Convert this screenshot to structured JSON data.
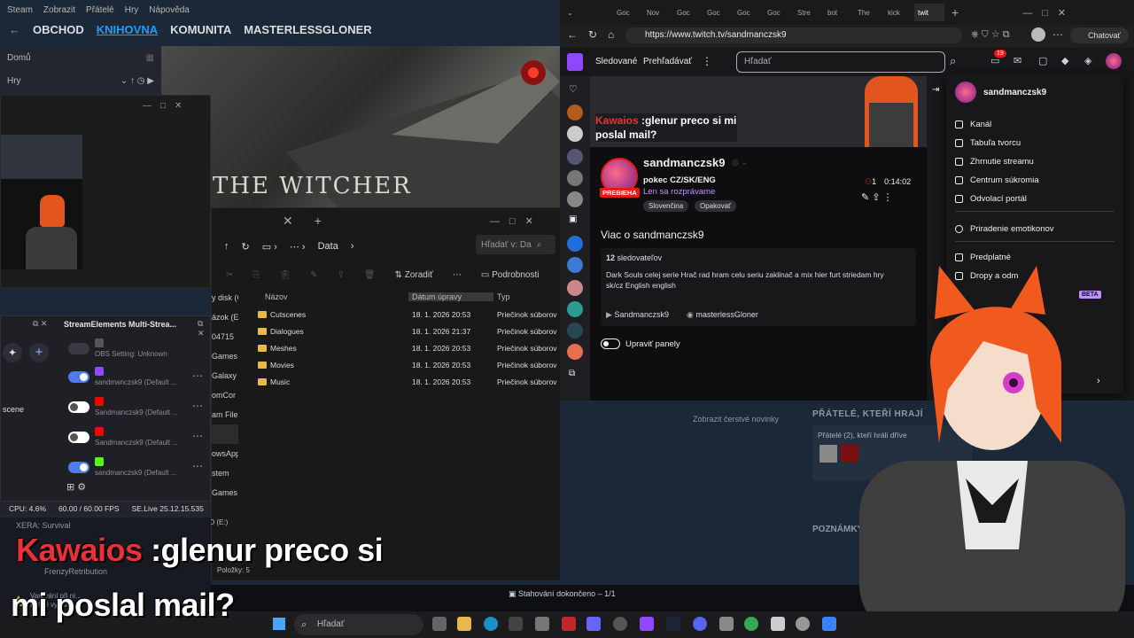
{
  "steam": {
    "menu": [
      "Steam",
      "Zobrazit",
      "Přátelé",
      "Hry",
      "Nápověda"
    ],
    "nav": [
      "OBCHOD",
      "KNIHOVNA",
      "KOMUNITA",
      "MASTERLESSGLONER"
    ],
    "nav_active_index": 1,
    "home_label": "Domů",
    "games_label": "Hry",
    "hero_title": "THE WITCHER",
    "news_link": "Zobrazit čerstvé novinky",
    "friends_heading": "PŘÁTELÉ, KTEŘÍ HRAJÍ",
    "friends_sub": "Přátelé (2), kteří hráli dříve",
    "notes_heading": "POZNÁMKY",
    "download_status": "Stahování dokončeno – 1/1"
  },
  "explorer": {
    "path": "Data",
    "search_placeholder": "Hľadať v: Da",
    "sort_label": "Zoradiť",
    "details_label": "Podrobnosti",
    "columns": [
      "Názov",
      "Dátum úpravy",
      "Typ"
    ],
    "nav_items": [
      "y disk (C",
      "ázok (E",
      "04715",
      "Games",
      "Galaxy",
      "omCor",
      "am File",
      "",
      "owsApp",
      "stem",
      "Games"
    ],
    "rows": [
      {
        "name": "Cutscenes",
        "date": "18. 1. 2026 20:53",
        "type": "Priečinok súborov"
      },
      {
        "name": "Dialogues",
        "date": "18. 1. 2026 21:37",
        "type": "Priečinok súborov"
      },
      {
        "name": "Meshes",
        "date": "18. 1. 2026 20:53",
        "type": "Priečinok súborov"
      },
      {
        "name": "Movies",
        "date": "18. 1. 2026 20:53",
        "type": "Priečinok súborov"
      },
      {
        "name": "Music",
        "date": "18. 1. 2026 20:53",
        "type": "Priečinok súborov"
      }
    ],
    "status": "Položky: 5",
    "drive": "SSD (E:)"
  },
  "streamelements": {
    "title": "StreamElements Multi-Strea...",
    "rows": [
      {
        "label": "OBS Setting: Unknown",
        "on": false,
        "icon_color": "#555555"
      },
      {
        "label": "sandmanczsk9 (Default ...",
        "on": true,
        "icon_color": "#9146ff"
      },
      {
        "label": "Sandmanczsk9 (Default ...",
        "on": false,
        "icon_color": "#ff0000"
      },
      {
        "label": "Sandmanczsk9 (Default ...",
        "on": false,
        "icon_color": "#ff0000"
      },
      {
        "label": "sandmanczsk9 (Default ...",
        "on": true,
        "icon_color": "#53fc18"
      }
    ],
    "scene_label": "scene"
  },
  "obs_status": {
    "cpu": "CPU: 4.6%",
    "fps": "60.00 / 60.00 FPS",
    "version": "SE.Live 25.12.15.535"
  },
  "browser": {
    "tabs": [
      "Goc",
      "Nov",
      "Goc",
      "Goc",
      "Goc",
      "Goc",
      "Stre",
      "bot",
      "The",
      "kick",
      "twit"
    ],
    "url": "https://www.twitch.tv/sandmanczsk9",
    "chat_button": "Chatovať"
  },
  "twitch": {
    "nav_following": "Sledované",
    "nav_browse": "Prehľadávať",
    "search_placeholder": "Hľadať",
    "notif_count": "19",
    "overlay_user": "Kawaios",
    "overlay_text": ":glenur preco si mi poslal mail?",
    "channel_name": "sandmanczsk9",
    "live_badge": "PREBIEHA",
    "stream_title": "pokec CZ/SK/ENG",
    "category": "Len sa rozprávame",
    "tags": [
      "Slovenčina",
      "Opakovať"
    ],
    "viewers": "1",
    "uptime": "0:14:02",
    "about_title": "Viac o sandmanczsk9",
    "followers_count": "12",
    "followers_label": "sledovateľov",
    "description": "Dark Souls celej serie Hrač rad hram celu seriu zaklinač a mix hier furt striedam hry sk/cz English english",
    "link_youtube": "Sandmanczsk9",
    "link_discord": "masterlessGloner",
    "edit_panels": "Upraviť panely"
  },
  "user_menu": {
    "username": "sandmanczsk9",
    "items": [
      "Kanál",
      "Tabuľa tvorcu",
      "Zhrnutie streamu",
      "Centrum súkromia",
      "Odvolací portál",
      "Priradenie emotikonov",
      "Predplatné",
      "Dropy a odm"
    ],
    "beta": "BETA"
  },
  "taskbar": {
    "search_placeholder": "Hľadať"
  },
  "game_notes": {
    "title": "XERA: Survival",
    "friend": "FrenzyRetribution",
    "warning": "Varování při ni...",
    "warning_sub": "Právě vydáno"
  },
  "caption": {
    "user": "Kawaios",
    "line1": " :glenur preco si",
    "line2": "mi poslal mail?"
  },
  "colors": {
    "twitch_purple": "#9146ff",
    "steam_blue": "#1a9fff",
    "live_red": "#e91916",
    "caption_user": "#e8323a"
  }
}
